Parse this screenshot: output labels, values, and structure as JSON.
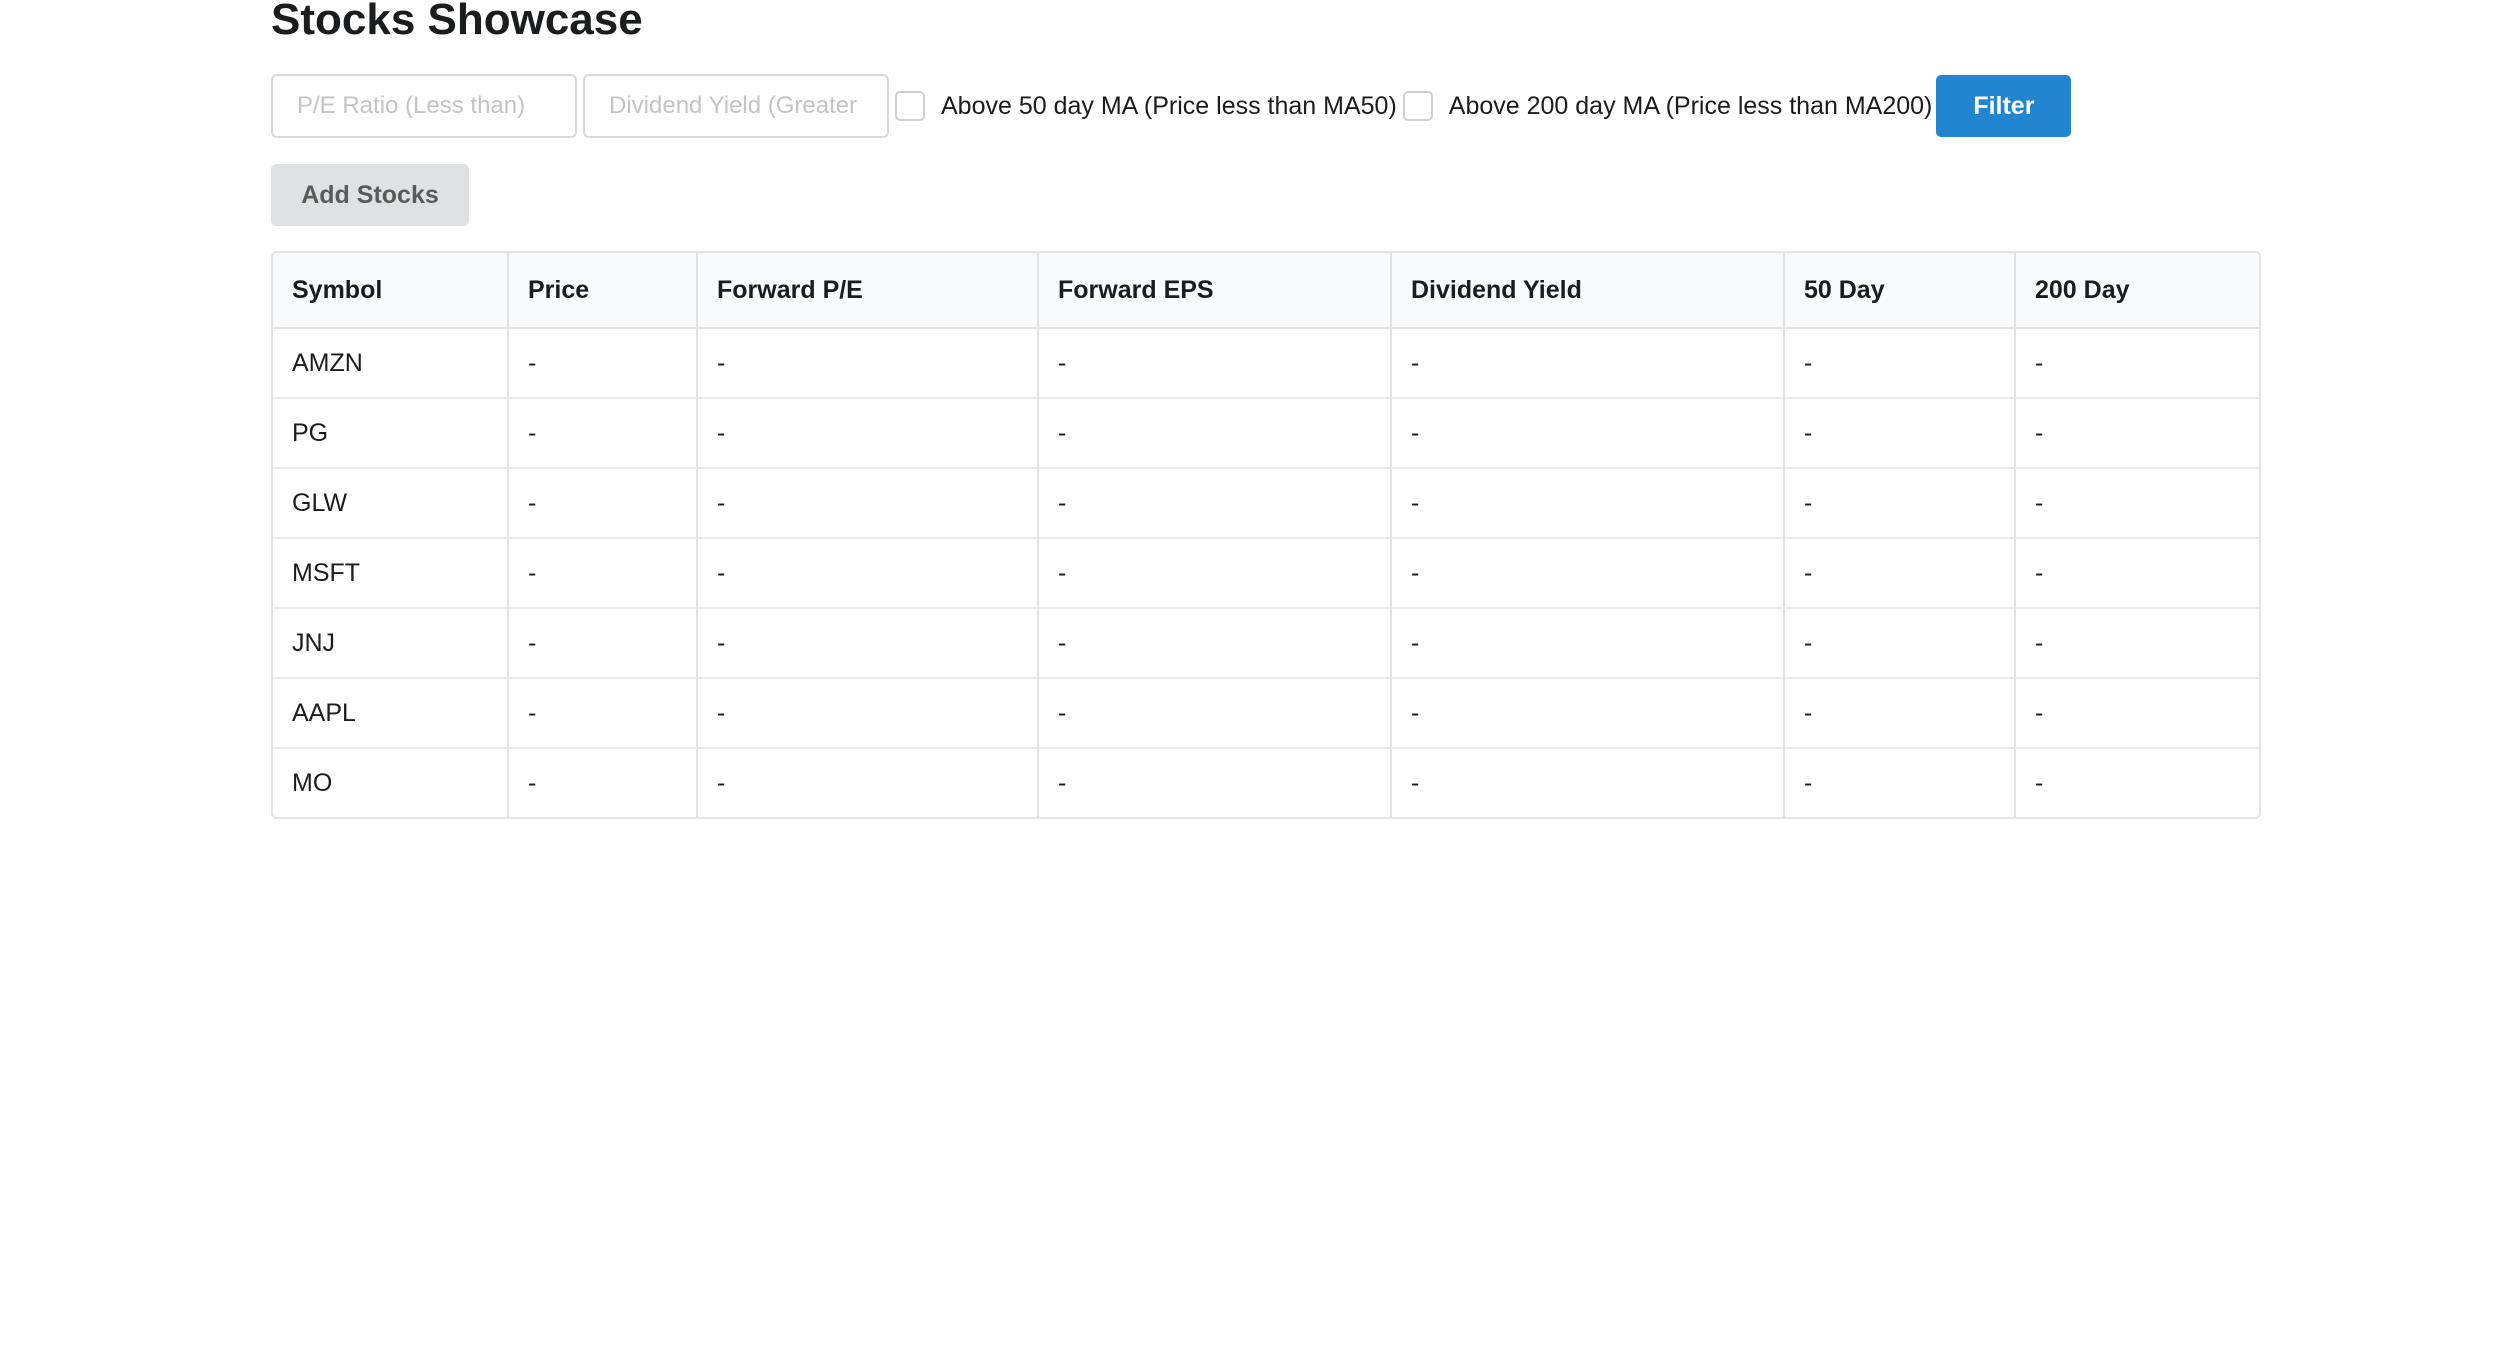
{
  "page": {
    "title": "Stocks Showcase"
  },
  "filters": {
    "pe_placeholder": "P/E Ratio (Less than)",
    "yield_placeholder": "Dividend Yield (Greater",
    "ma50_label": "Above 50 day MA (Price less than MA50)",
    "ma200_label": "Above 200 day MA (Price less than MA200)",
    "filter_button": "Filter"
  },
  "actions": {
    "add_stocks": "Add Stocks"
  },
  "colors": {
    "primary_button": "#2185d0",
    "secondary_button": "#e0e1e2",
    "table_header_bg": "#f9fafb"
  },
  "table": {
    "headers": [
      "Symbol",
      "Price",
      "Forward P/E",
      "Forward EPS",
      "Dividend Yield",
      "50 Day",
      "200 Day"
    ],
    "rows": [
      [
        "AMZN",
        "-",
        "-",
        "-",
        "-",
        "-",
        "-"
      ],
      [
        "PG",
        "-",
        "-",
        "-",
        "-",
        "-",
        "-"
      ],
      [
        "GLW",
        "-",
        "-",
        "-",
        "-",
        "-",
        "-"
      ],
      [
        "MSFT",
        "-",
        "-",
        "-",
        "-",
        "-",
        "-"
      ],
      [
        "JNJ",
        "-",
        "-",
        "-",
        "-",
        "-",
        "-"
      ],
      [
        "AAPL",
        "-",
        "-",
        "-",
        "-",
        "-",
        "-"
      ],
      [
        "MO",
        "-",
        "-",
        "-",
        "-",
        "-",
        "-"
      ]
    ]
  }
}
